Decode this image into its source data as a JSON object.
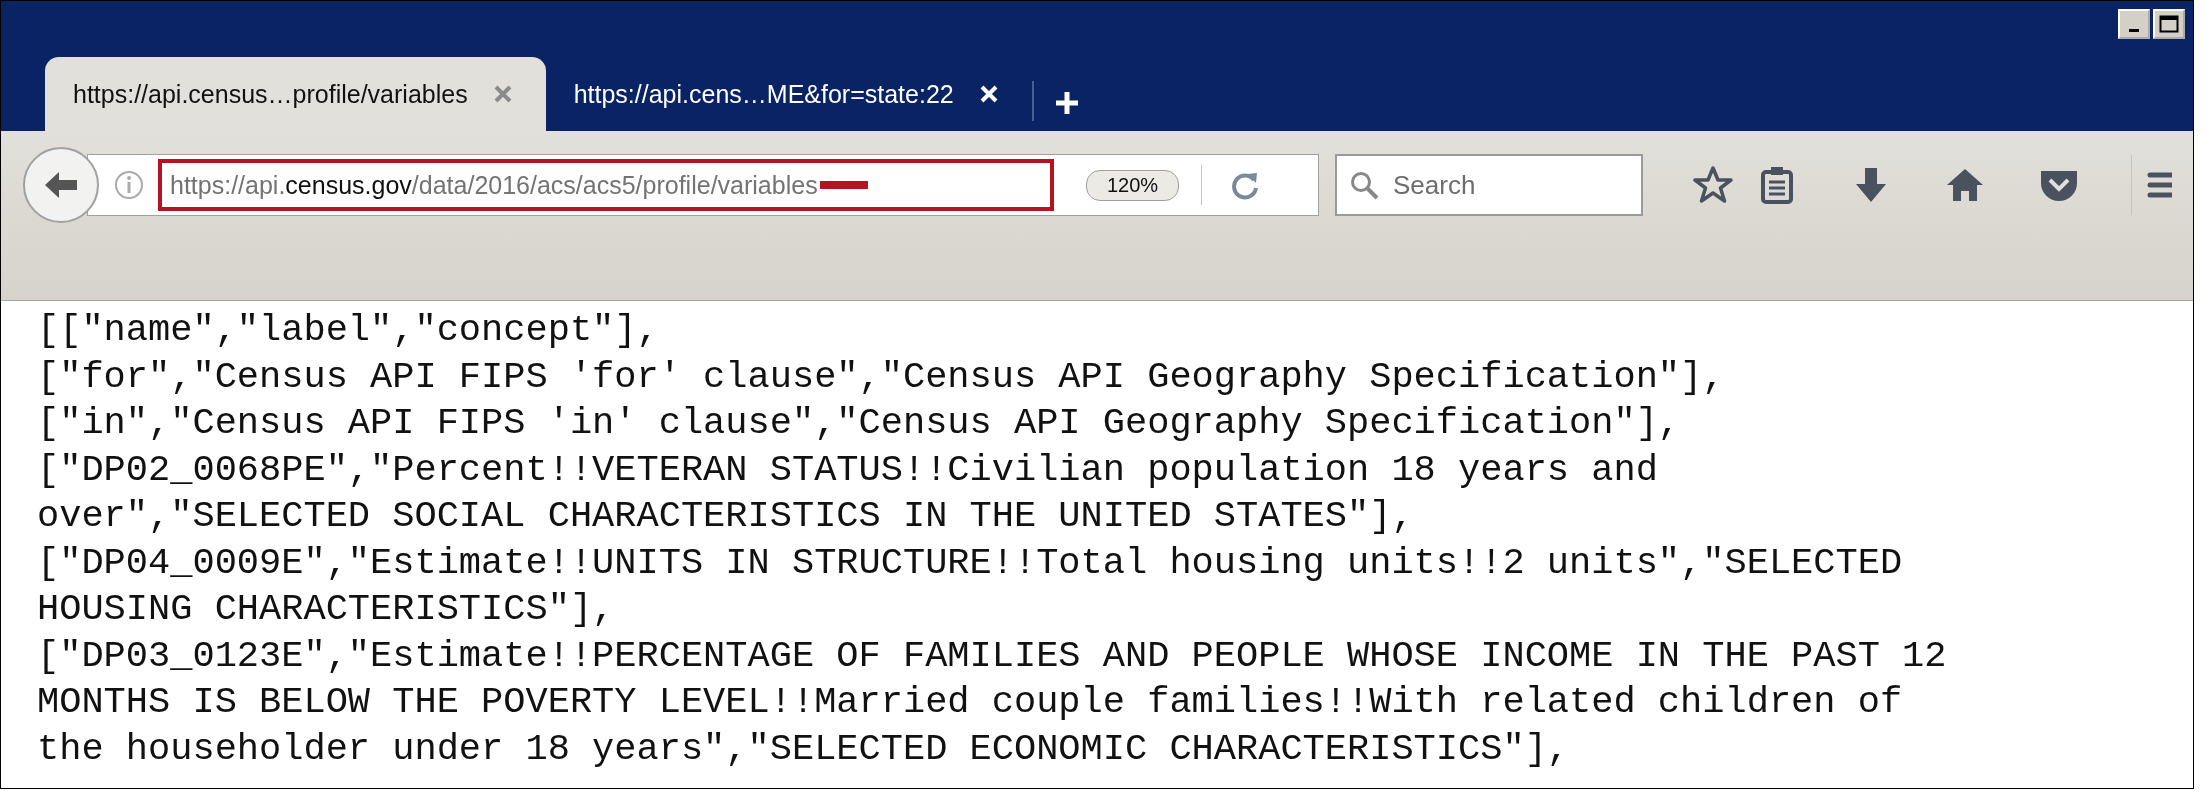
{
  "tabs": [
    {
      "title": "https://api.census…profile/variables",
      "selected": true
    },
    {
      "title": "https://api.cens…ME&for=state:22",
      "selected": false
    }
  ],
  "address_bar": {
    "url_scheme_host": "https://api.",
    "url_domain": "census.gov",
    "url_path": "/data/2016/acs/acs5/profile/variables",
    "redacted": true,
    "zoom": "120%"
  },
  "search": {
    "placeholder": "Search"
  },
  "content": {
    "lines": [
      "[[\"name\",\"label\",\"concept\"],",
      "[\"for\",\"Census API FIPS 'for' clause\",\"Census API Geography Specification\"],",
      "[\"in\",\"Census API FIPS 'in' clause\",\"Census API Geography Specification\"],",
      "[\"DP02_0068PE\",\"Percent!!VETERAN STATUS!!Civilian population 18 years and",
      "over\",\"SELECTED SOCIAL CHARACTERISTICS IN THE UNITED STATES\"],",
      "[\"DP04_0009E\",\"Estimate!!UNITS IN STRUCTURE!!Total housing units!!2 units\",\"SELECTED",
      "HOUSING CHARACTERISTICS\"],",
      "[\"DP03_0123E\",\"Estimate!!PERCENTAGE OF FAMILIES AND PEOPLE WHOSE INCOME IN THE PAST 12",
      "MONTHS IS BELOW THE POVERTY LEVEL!!Married couple families!!With related children of",
      "the householder under 18 years\",\"SELECTED ECONOMIC CHARACTERISTICS\"],"
    ]
  }
}
